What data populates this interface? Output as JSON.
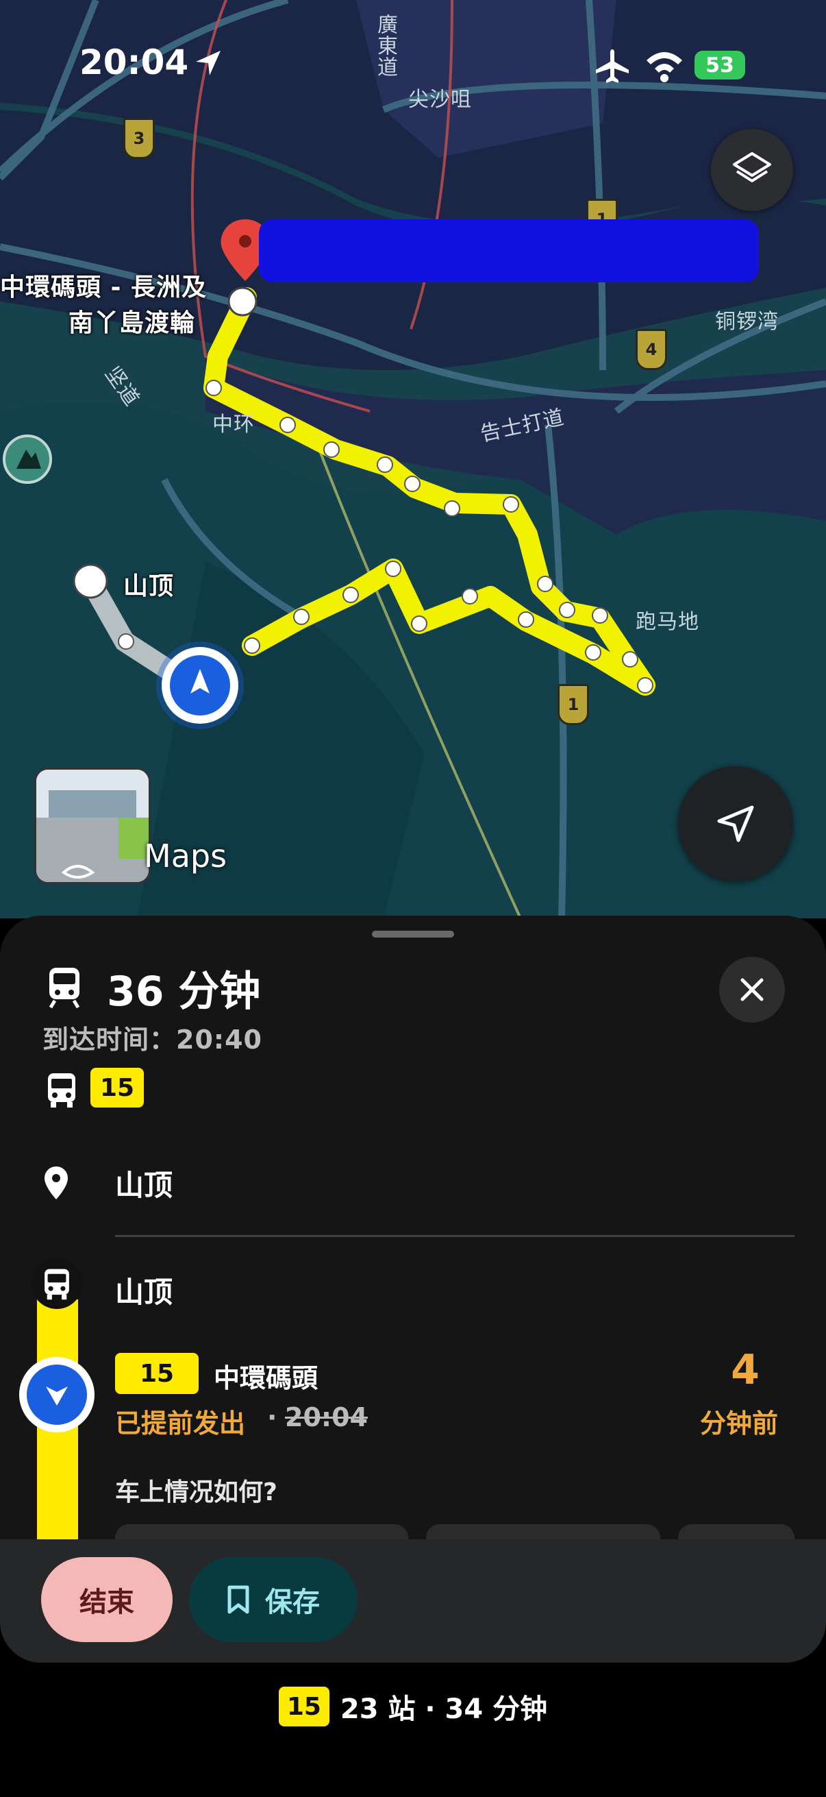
{
  "status_bar": {
    "time": "20:04",
    "battery": "53"
  },
  "map": {
    "labels": {
      "tsim_sha_tsui": "尖沙咀",
      "canton_road": "廣東道",
      "central_pier_line1": "中環碼頭 - 長洲及",
      "central_pier_line2": "南丫島渡輪",
      "causeway_bay": "铜锣湾",
      "gloucester_road": "告士打道",
      "central": "中环",
      "kennedy_road": "坚道",
      "the_peak": "山顶",
      "happy_valley": "跑马地",
      "maps_watermark": "Maps"
    },
    "shields": {
      "route3": "3",
      "route1_north": "1",
      "route4": "4",
      "route1_south": "1"
    },
    "route_color": "#f2f200",
    "accent_blue": "#1a5fe0"
  },
  "trip": {
    "duration": "36 分钟",
    "arrival": "到达时间：20:40",
    "line": "15",
    "destination": "山顶",
    "boarding_stop": "山顶",
    "line_destination": "中環碼頭",
    "departure_status": "已提前发出",
    "separator": "·",
    "scheduled_time": "20:04",
    "minutes_ago_value": "4",
    "minutes_ago_unit": "分钟前",
    "crowd_question": "车上情况如何?"
  },
  "actions": {
    "end_label": "结束",
    "save_label": "保存"
  },
  "footer": {
    "line": "15",
    "summary": "23 站 · 34 分钟"
  }
}
